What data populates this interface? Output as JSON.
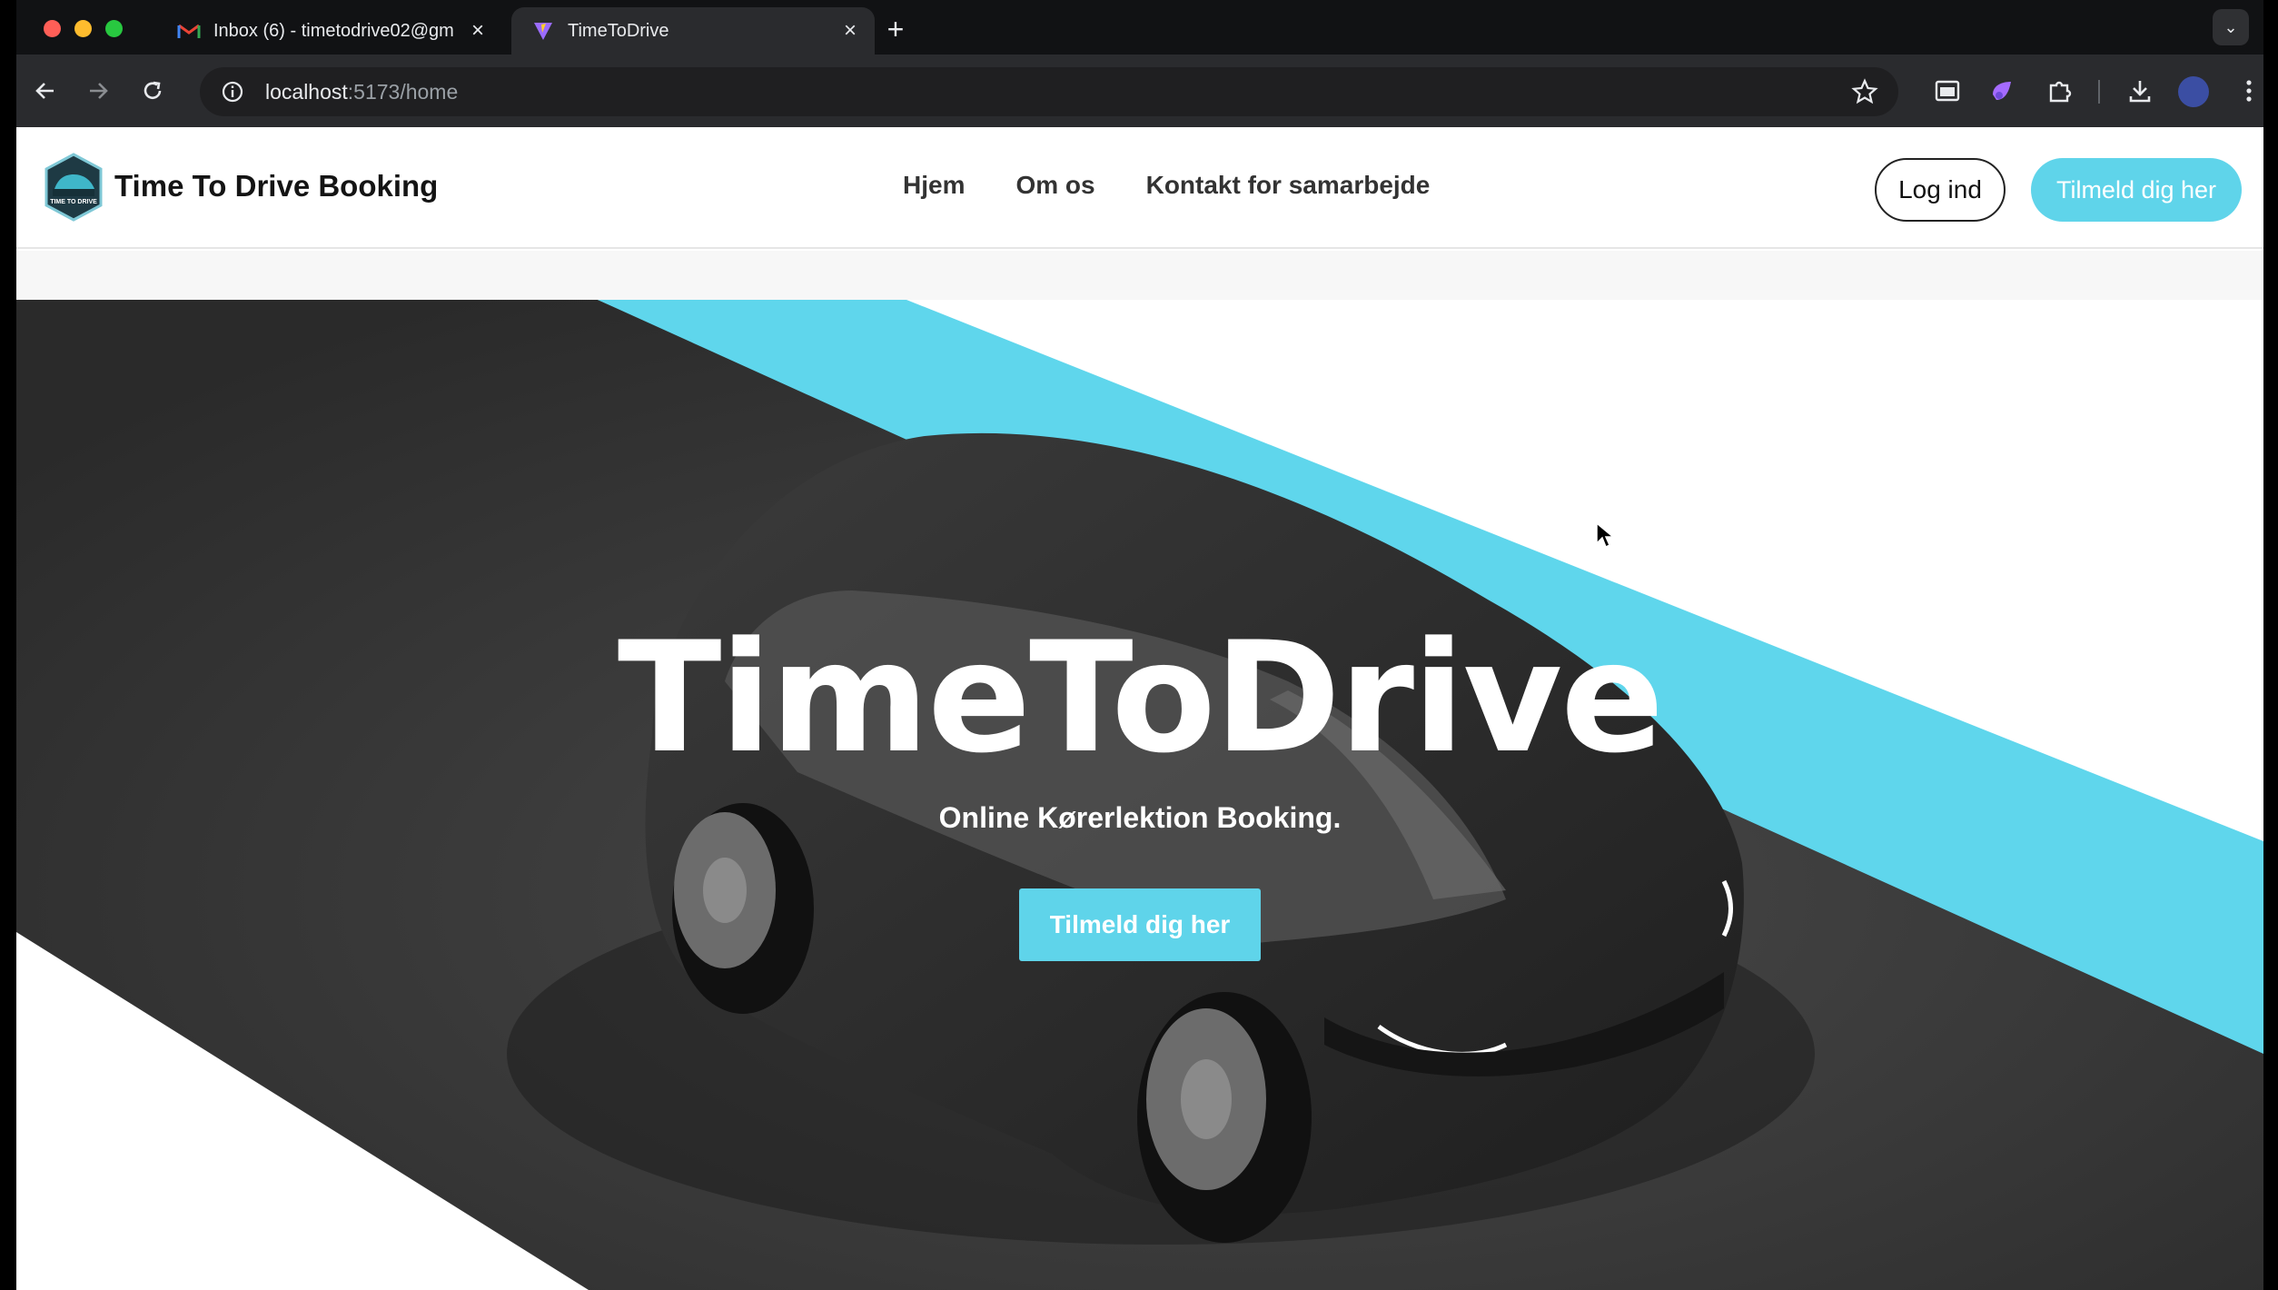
{
  "browser": {
    "tabs": [
      {
        "title": "Inbox (6) - timetodrive02@gm",
        "favicon": "gmail-icon",
        "active": false
      },
      {
        "title": "TimeToDrive",
        "favicon": "vite-icon",
        "active": true
      }
    ],
    "url_host": "localhost",
    "url_path": ":5173/home"
  },
  "header": {
    "brand": "Time To Drive Booking",
    "logo_text": "TIME TO DRIVE",
    "nav": [
      "Hjem",
      "Om os",
      "Kontakt for samarbejde"
    ],
    "login_label": "Log ind",
    "signup_label": "Tilmeld dig her"
  },
  "hero": {
    "title": "TimeToDrive",
    "subtitle": "Online Kørerlektion Booking.",
    "cta_label": "Tilmeld dig her"
  },
  "colors": {
    "accent": "#5fd4ea",
    "road": "#3c3c3c",
    "car": "#2b2b2b"
  }
}
